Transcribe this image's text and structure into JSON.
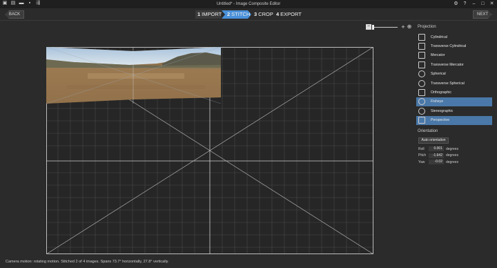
{
  "window": {
    "title": "Untitled* - Image Composite Editor",
    "quick_access_icons": [
      "new-panorama-icon",
      "new-from-video-icon",
      "open-icon",
      "save-icon",
      "compose-icon"
    ],
    "controls": {
      "settings": "⚙",
      "help": "?",
      "minimize": "–",
      "maximize": "□",
      "close": "✕"
    }
  },
  "nav": {
    "back_label": "BACK",
    "next_label": "NEXT",
    "steps": [
      {
        "num": "1",
        "label": "IMPORT"
      },
      {
        "num": "2",
        "label": "STITCH",
        "active": true
      },
      {
        "num": "3",
        "label": "CROP"
      },
      {
        "num": "4",
        "label": "EXPORT"
      }
    ]
  },
  "zoom": {
    "minus": "−",
    "plus": "+",
    "fit": "⊕"
  },
  "panel": {
    "projection_title": "Projection",
    "projections": [
      {
        "label": "Cylindrical",
        "icon": "cylindrical-icon"
      },
      {
        "label": "Transverse Cylindrical",
        "icon": "transverse-cylindrical-icon"
      },
      {
        "label": "Mercator",
        "icon": "mercator-icon"
      },
      {
        "label": "Transverse Mercator",
        "icon": "transverse-mercator-icon"
      },
      {
        "label": "Spherical",
        "icon": "spherical-icon"
      },
      {
        "label": "Transverse Spherical",
        "icon": "transverse-spherical-icon"
      },
      {
        "label": "Orthographic",
        "icon": "orthographic-icon"
      },
      {
        "label": "Fisheye",
        "icon": "fisheye-icon",
        "selected": true
      },
      {
        "label": "Stereographic",
        "icon": "stereographic-icon"
      },
      {
        "label": "Perspective",
        "icon": "perspective-icon",
        "selected": true
      }
    ],
    "orientation_title": "Orientation",
    "auto_orientation_label": "Auto orientation",
    "orientation": [
      {
        "key": "Roll",
        "value": "0.001",
        "unit": "degrees"
      },
      {
        "key": "Pitch",
        "value": "-1.642",
        "unit": "degrees"
      },
      {
        "key": "Yaw",
        "value": "-0.02",
        "unit": "degrees"
      }
    ]
  },
  "status": "Camera motion: rotating motion. Stitched 2 of 4 images. Spans 73.7° horizontally, 27.8° vertically.",
  "colors": {
    "accent": "#4a90d9",
    "selected": "#4a78a8",
    "background": "#2b2b2b"
  }
}
